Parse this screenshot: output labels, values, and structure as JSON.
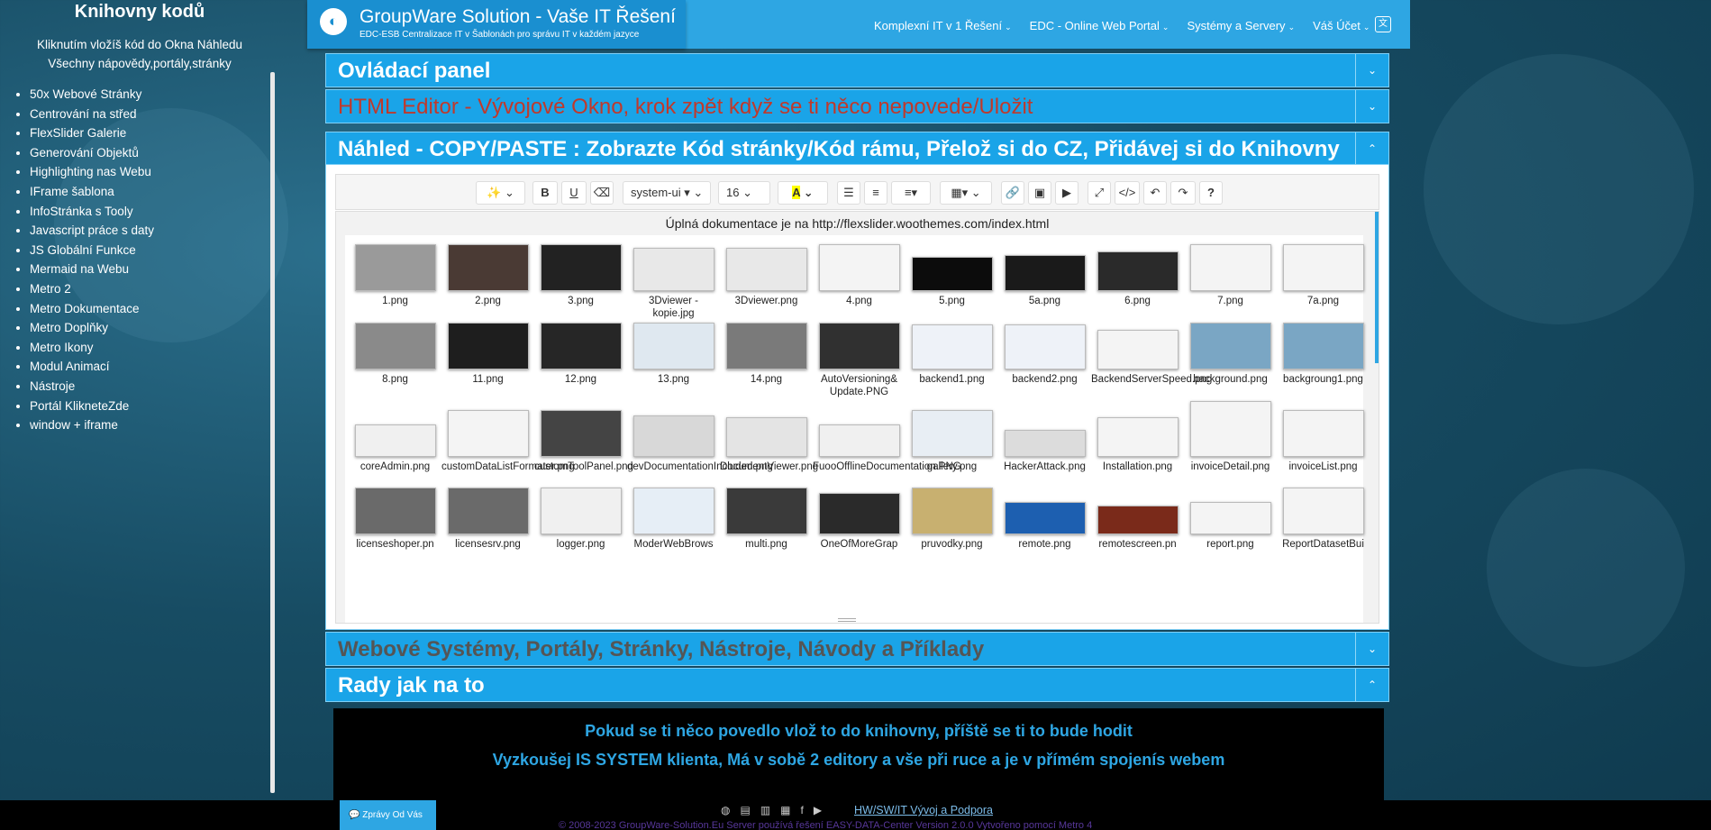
{
  "sidebar": {
    "title": "Knihovny kodů",
    "subtitle_line1": "Kliknutím vložíš kód do Okna Náhledu",
    "subtitle_line2": "Všechny nápovědy,portály,stránky",
    "items": [
      "50x Webové Stránky",
      "Centrování na střed",
      "FlexSlider Galerie",
      "Generování Objektů",
      "Highlighting nas Webu",
      "IFrame šablona",
      "InfoStránka s Tooly",
      "Javascript práce s daty",
      "JS Globální Funkce",
      "Mermaid na Webu",
      "Metro 2",
      "Metro Dokumentace",
      "Metro Doplňky",
      "Metro Ikony",
      "Modul Animací",
      "Nástroje",
      "Portál KlikneteZde",
      "window + iframe"
    ]
  },
  "brand": {
    "title": "GroupWare Solution - Vaše IT Řešení",
    "subtitle": "EDC-ESB Centralizace IT v Šablonách pro správu IT v každém jazyce"
  },
  "menu": [
    "Komplexní IT v 1 Řešení",
    "EDC - Online Web Portal",
    "Systémy a Servery",
    "Váš Účet"
  ],
  "accordions": {
    "control_panel": "Ovládací panel",
    "html_editor": "HTML Editor - Vývojové Okno, krok zpět když se ti něco nepovede/Uložit",
    "preview": "Náhled - COPY/PASTE : Zobrazte Kód stránky/Kód rámu, Přelož si do CZ, Přidávej si do Knihovny",
    "web_systems": "Webové Systémy, Portály, Stránky, Nástroje, Návody a Příklady",
    "tips": "Rady jak na to"
  },
  "toolbar": {
    "font": "system-ui",
    "size": "16"
  },
  "doc_link": "Úplná dokumentace je na http://flexslider.woothemes.com/index.html",
  "gallery": [
    [
      "1.png",
      "2.png",
      "3.png",
      "3Dviewer - kopie.jpg",
      "3Dviewer.png",
      "4.png",
      "5.png",
      "5a.png",
      "6.png",
      "7.png",
      "7a.png"
    ],
    [
      "8.png",
      "11.png",
      "12.png",
      "13.png",
      "14.png",
      "AutoVersioning& Update.PNG",
      "backend1.png",
      "backend2.png",
      "BackendServerSpeed.png",
      "background.png",
      "backgroung1.png"
    ],
    [
      "coreAdmin.png",
      "customDataListFormater.png",
      "customToolPanel.png",
      "devDocumentationIncluded.png",
      "DocumentViewer.png",
      "FuooOfflineDocumentation.PNG",
      "gallery.png",
      "HackerAttack.png",
      "Installation.png",
      "invoiceDetail.png",
      "invoiceList.png"
    ],
    [
      "licenseshoper.pn",
      "licensesrv.png",
      "logger.png",
      "ModerWebBrows",
      "multi.png",
      "OneOfMoreGrap",
      "pruvodky.png",
      "remote.png",
      "remotescreen.pn",
      "report.png",
      "ReportDatasetBui"
    ]
  ],
  "thumb_colors": [
    [
      "#9a9a9a",
      "#4a3a34",
      "#222222",
      "#e8e8e8",
      "#e8e8e8",
      "#f4f4f4",
      "#0c0c0c",
      "#1a1a1a",
      "#2a2a2a",
      "#f4f4f4",
      "#f4f4f4"
    ],
    [
      "#8a8a8a",
      "#1e1e1e",
      "#262626",
      "#dfe8f0",
      "#7a7a7a",
      "#303030",
      "#eef2f8",
      "#eef2f8",
      "#f4f4f4",
      "#7aa6c4",
      "#7aa6c4"
    ],
    [
      "#f0f0f0",
      "#f4f4f4",
      "#444444",
      "#d8d8d8",
      "#e4e4e4",
      "#f0f0f0",
      "#e8eef4",
      "#dcdcdc",
      "#f4f4f4",
      "#f4f4f4",
      "#f4f4f4"
    ],
    [
      "#6a6a6a",
      "#6a6a6a",
      "#f0f0f0",
      "#e6eef6",
      "#3a3a3a",
      "#2a2a2a",
      "#c8b070",
      "#1d5fb0",
      "#7a2a1a",
      "#f4f4f4",
      "#f4f4f4"
    ]
  ],
  "tips": [
    "Pokud se ti něco povedlo vlož to do knihovny, příště se ti to bude hodit",
    "Vyzkoušej IS SYSTEM klienta, Má v sobě 2 editory a vše při ruce a je v přímém spojenís webem"
  ],
  "footer": {
    "chat_button": "Zprávy Od Vás",
    "support_link": "HW/SW/IT Vývoj a Podpora",
    "copyright": "© 2008-2023 GroupWare-Solution.Eu Server používá řešení EASY-DATA-Center Version 2.0.0 Vytvořeno pomocí Metro 4"
  },
  "colors": {
    "accent": "#1aa4e8",
    "accordion_text_red": "#c0392b",
    "accordion_text_gray": "#555555",
    "tips_text": "#2ea6e3"
  }
}
